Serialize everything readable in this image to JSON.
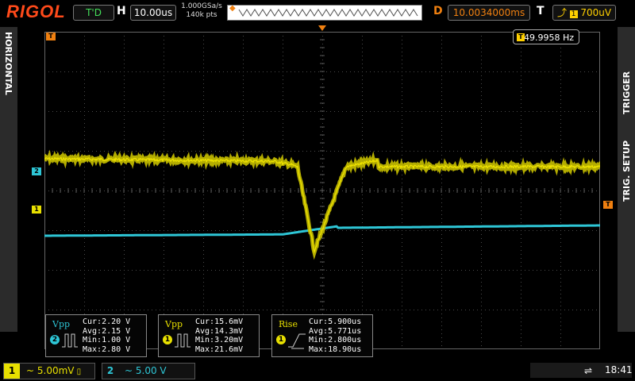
{
  "header": {
    "brand": "RIGOL",
    "run_state": "T'D",
    "h_label": "H",
    "timebase": "10.00us",
    "sample_rate": "1.000GSa/s",
    "memory_depth": "140k pts",
    "delay_label": "D",
    "delay": "10.0034000ms",
    "trigger_label": "T",
    "trigger_level": "700uV"
  },
  "side_tabs": {
    "left": "HORIZONTAL",
    "right_top": "TRIGGER",
    "right_bottom": "TRIG. SETUP"
  },
  "screen": {
    "frequency": "49.9958 Hz",
    "marker_ch1": "1",
    "marker_ch2": "2",
    "marker_trigger": "T"
  },
  "colors": {
    "ch1": "#e8e000",
    "ch2": "#2ec6d6",
    "trigger": "#f08010",
    "grid": "#4a4a4a"
  },
  "measurements": [
    {
      "name": "Vpp",
      "channel": "2",
      "cur": "Cur:2.20 V",
      "avg": "Avg:2.15 V",
      "min": "Min:1.00 V",
      "max": "Max:2.80 V"
    },
    {
      "name": "Vpp",
      "channel": "1",
      "cur": "Cur:15.6mV",
      "avg": "Avg:14.3mV",
      "min": "Min:3.20mV",
      "max": "Max:21.6mV"
    },
    {
      "name": "Rise",
      "channel": "1",
      "cur": "Cur:5.900us",
      "avg": "Avg:5.771us",
      "min": "Min:2.800us",
      "max": "Max:18.90us"
    }
  ],
  "footer": {
    "ch1_num": "1",
    "ch1_scale": "~ 5.00mV",
    "ch2_num": "2",
    "ch2_scale": "~   5.00 V",
    "time": "18:41"
  }
}
